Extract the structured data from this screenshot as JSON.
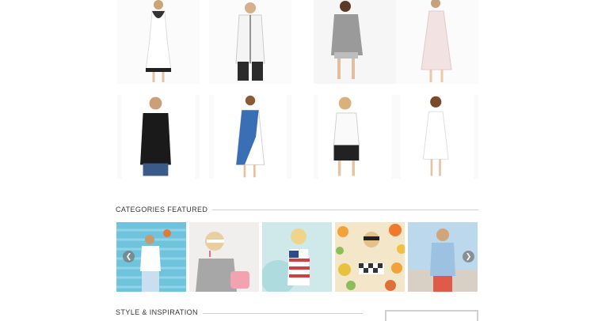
{
  "sections": {
    "categories_featured": "CATEGORIES FEATURED",
    "style_inspiration": "STYLE & INSPIRATION"
  },
  "carousel": {
    "prev_icon": "chevron-left-icon",
    "next_icon": "chevron-right-icon"
  },
  "products": [
    {
      "item": "white dress with black lace trim"
    },
    {
      "item": "white shirt with black pants"
    },
    {
      "item": "grey ruffle top with shorts"
    },
    {
      "item": "light pink lace dress"
    },
    {
      "item": "black t-shirt with jeans"
    },
    {
      "item": "blue and white geometric dress"
    },
    {
      "item": "white top with black leather shorts"
    },
    {
      "item": "white lace slip dress"
    }
  ],
  "categories": [
    {
      "item": "man on blue striped background"
    },
    {
      "item": "blonde girl in grey with pink bag"
    },
    {
      "item": "blonde woman in flag top"
    },
    {
      "item": "woman with sunglasses on floral"
    },
    {
      "item": "man in blue shirt on boardwalk"
    }
  ],
  "colors": {
    "line": "#cfcfcf",
    "arrow_bg": "#787878",
    "text": "#333333"
  }
}
